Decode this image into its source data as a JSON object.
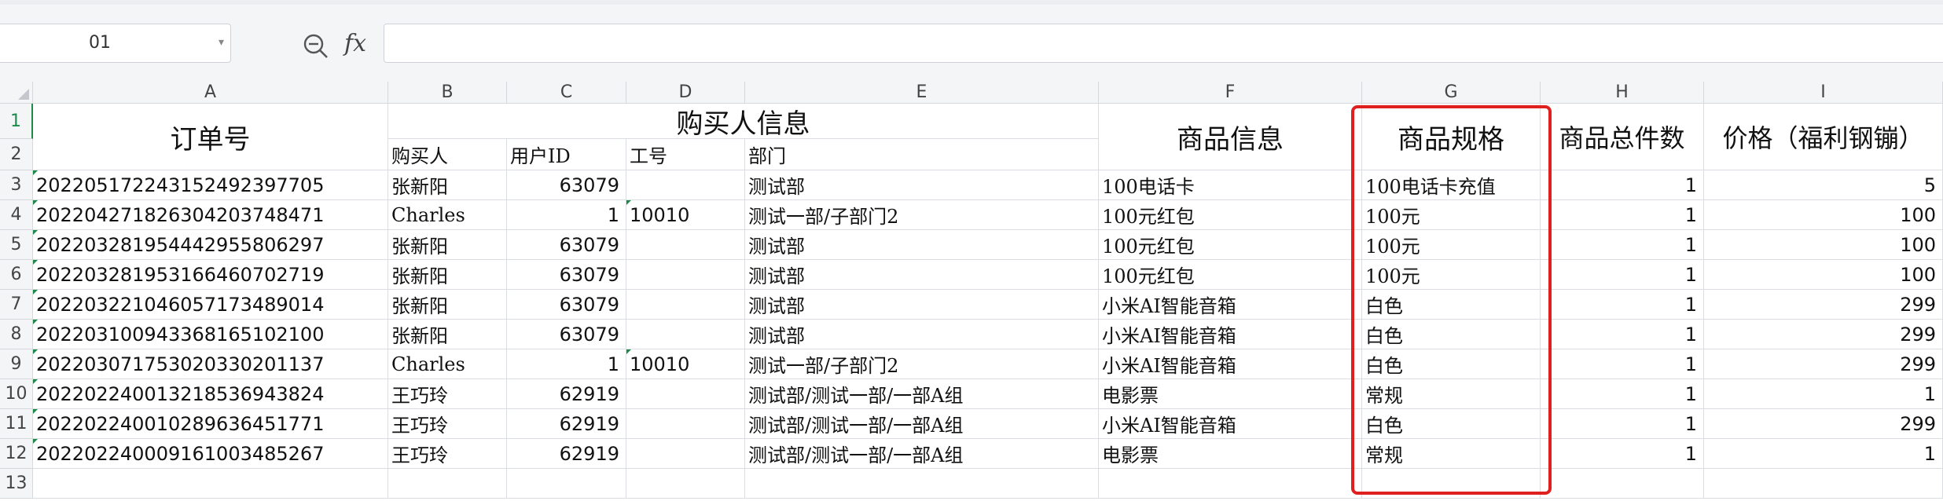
{
  "name_box": {
    "value": "01"
  },
  "formula": {
    "fx_label": "fx",
    "value": ""
  },
  "columns": [
    "A",
    "B",
    "C",
    "D",
    "E",
    "F",
    "G",
    "H",
    "I"
  ],
  "row_numbers": [
    "1",
    "2",
    "3",
    "4",
    "5",
    "6",
    "7",
    "8",
    "9",
    "10",
    "11",
    "12",
    "13"
  ],
  "headers": {
    "order_no": "订单号",
    "buyer_group": "购买人信息",
    "buyer": "购买人",
    "user_id": "用户ID",
    "employee_no": "工号",
    "department": "部门",
    "product_info": "商品信息",
    "product_spec": "商品规格",
    "total_qty": "商品总件数",
    "price": "价格（福利钢镚）"
  },
  "rows": [
    {
      "order": "20220517224315249239770​5",
      "buyer": "张新阳",
      "uid": "63079",
      "emp": "",
      "dept": "测试部",
      "product": "100电话卡",
      "spec": "100电话卡充值",
      "qty": "1",
      "price": "5"
    },
    {
      "order": "20220427182630420374847​1",
      "buyer": "Charles",
      "uid": "1",
      "emp": "10010",
      "dept": "测试一部/子部门2",
      "product": "100元红包",
      "spec": "100元",
      "qty": "1",
      "price": "100"
    },
    {
      "order": "20220328195444295580629​7",
      "buyer": "张新阳",
      "uid": "63079",
      "emp": "",
      "dept": "测试部",
      "product": "100元红包",
      "spec": "100元",
      "qty": "1",
      "price": "100"
    },
    {
      "order": "20220328195316646070271​9",
      "buyer": "张新阳",
      "uid": "63079",
      "emp": "",
      "dept": "测试部",
      "product": "100元红包",
      "spec": "100元",
      "qty": "1",
      "price": "100"
    },
    {
      "order": "20220322104605717348901​4",
      "buyer": "张新阳",
      "uid": "63079",
      "emp": "",
      "dept": "测试部",
      "product": "小米AI智能音箱",
      "spec": "白色",
      "qty": "1",
      "price": "299"
    },
    {
      "order": "20220310094336816510210​0",
      "buyer": "张新阳",
      "uid": "63079",
      "emp": "",
      "dept": "测试部",
      "product": "小米AI智能音箱",
      "spec": "白色",
      "qty": "1",
      "price": "299"
    },
    {
      "order": "20220307175302033020113​7",
      "buyer": "Charles",
      "uid": "1",
      "emp": "10010",
      "dept": "测试一部/子部门2",
      "product": "小米AI智能音箱",
      "spec": "白色",
      "qty": "1",
      "price": "299"
    },
    {
      "order": "20220224001321853694382​4",
      "buyer": "王巧玲",
      "uid": "62919",
      "emp": "",
      "dept": "测试部/测试一部/一部A组",
      "product": "电影票",
      "spec": "常规",
      "qty": "1",
      "price": "1"
    },
    {
      "order": "20220224001028963645177​1",
      "buyer": "王巧玲",
      "uid": "62919",
      "emp": "",
      "dept": "测试部/测试一部/一部A组",
      "product": "小米AI智能音箱",
      "spec": "白色",
      "qty": "1",
      "price": "299"
    },
    {
      "order": "20220224000916100348526​7",
      "buyer": "王巧玲",
      "uid": "62919",
      "emp": "",
      "dept": "测试部/测试一部/一部A组",
      "product": "电影票",
      "spec": "常规",
      "qty": "1",
      "price": "1"
    }
  ],
  "colors": {
    "highlight": "#e0201f",
    "active_row": "#1d8a4a"
  }
}
